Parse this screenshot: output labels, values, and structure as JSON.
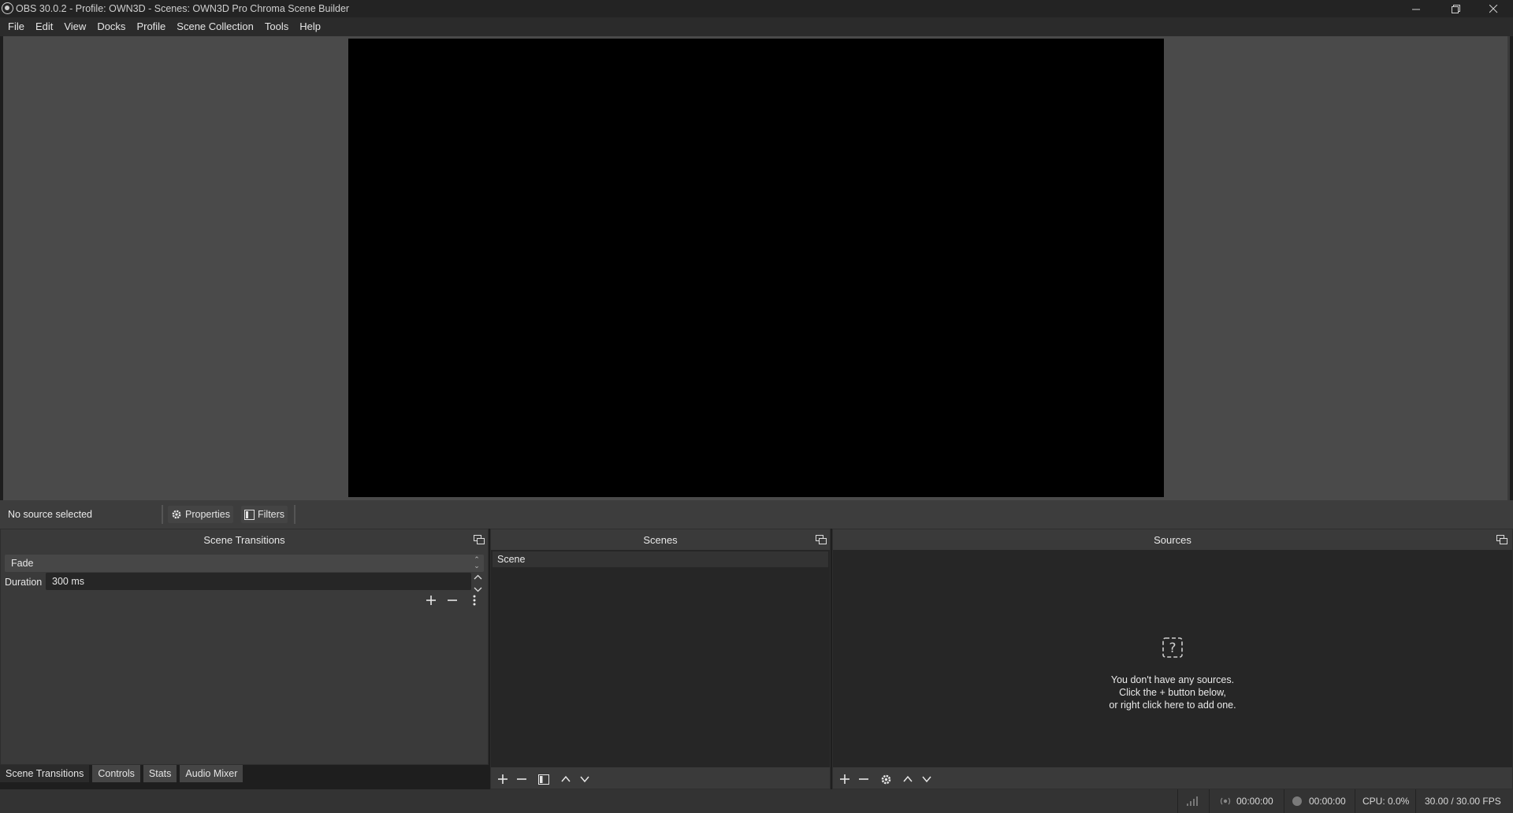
{
  "window": {
    "title": "OBS 30.0.2 - Profile: OWN3D - Scenes: OWN3D Pro Chroma Scene Builder",
    "controls": [
      "minimize-icon",
      "restore-icon",
      "close-icon"
    ]
  },
  "menubar": {
    "items": [
      "File",
      "Edit",
      "View",
      "Docks",
      "Profile",
      "Scene Collection",
      "Tools",
      "Help"
    ]
  },
  "source_toolbar": {
    "status": "No source selected",
    "properties_label": "Properties",
    "filters_label": "Filters"
  },
  "transitions_dock": {
    "title": "Scene Transitions",
    "selected_transition": "Fade",
    "duration_label": "Duration",
    "duration_value": "300 ms"
  },
  "scenes_dock": {
    "title": "Scenes",
    "scenes": [
      "Scene"
    ]
  },
  "sources_dock": {
    "title": "Sources",
    "empty_line1": "You don't have any sources.",
    "empty_line2": "Click the + button below,",
    "empty_line3": "or right click here to add one."
  },
  "bottom_tabs": [
    "Scene Transitions",
    "Controls",
    "Stats",
    "Audio Mixer"
  ],
  "statusbar": {
    "stream_time": "00:00:00",
    "record_time": "00:00:00",
    "cpu": "CPU: 0.0%",
    "fps": "30.00 / 30.00 FPS"
  },
  "colors": {
    "preview_background": "#4a4a4a",
    "canvas": "#000000",
    "dock_background": "#3a3a3a",
    "list_background": "#262626"
  }
}
